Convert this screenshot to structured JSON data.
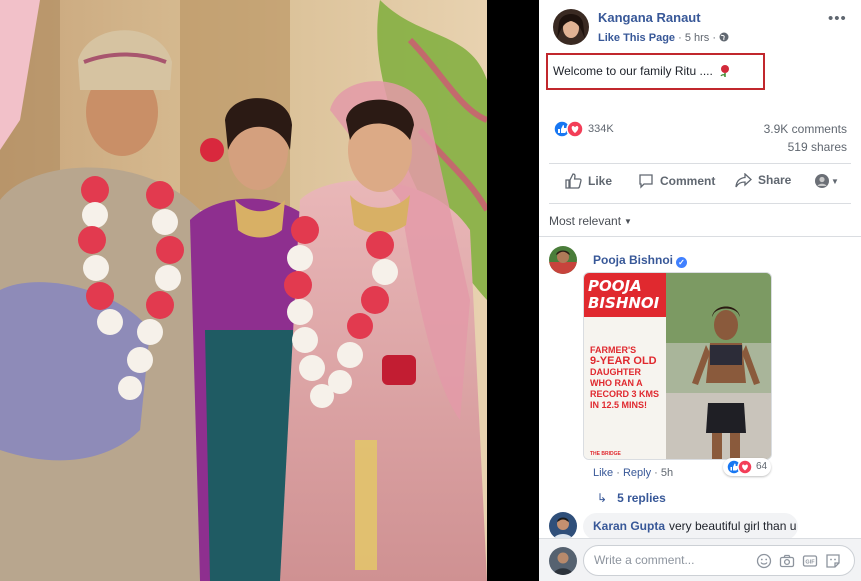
{
  "post": {
    "author": "Kangana Ranaut",
    "like_page": "Like This Page",
    "time": "5 hrs",
    "caption": "Welcome to our family Ritu ....",
    "reaction_count": "334K",
    "comments_count": "3.9K comments",
    "shares_count": "519 shares"
  },
  "actions": {
    "like": "Like",
    "comment": "Comment",
    "share": "Share"
  },
  "comments_filter": "Most relevant",
  "comments": [
    {
      "name": "Pooja Bishnoi",
      "card": {
        "title_line1": "POOJA",
        "title_line2": "BISHNOI",
        "text_1": "FARMER'S",
        "text_2": "9-YEAR OLD",
        "text_3": "DAUGHTER",
        "text_4": "WHO RAN A",
        "text_5": "RECORD 3 KMS",
        "text_6": "IN 12.5 MINS!",
        "brand": "THE BRIDGE"
      },
      "like": "Like",
      "reply": "Reply",
      "time": "5h",
      "reaction_count": "64",
      "replies": "5 replies"
    },
    {
      "name": "Karan Gupta",
      "text": "very beautiful girl than u"
    }
  ],
  "composer": {
    "placeholder": "Write a comment..."
  },
  "colors": {
    "link": "#385898",
    "highlight_border": "#c1272d",
    "like_blue": "#1877f2",
    "love_red": "#f33e58"
  }
}
